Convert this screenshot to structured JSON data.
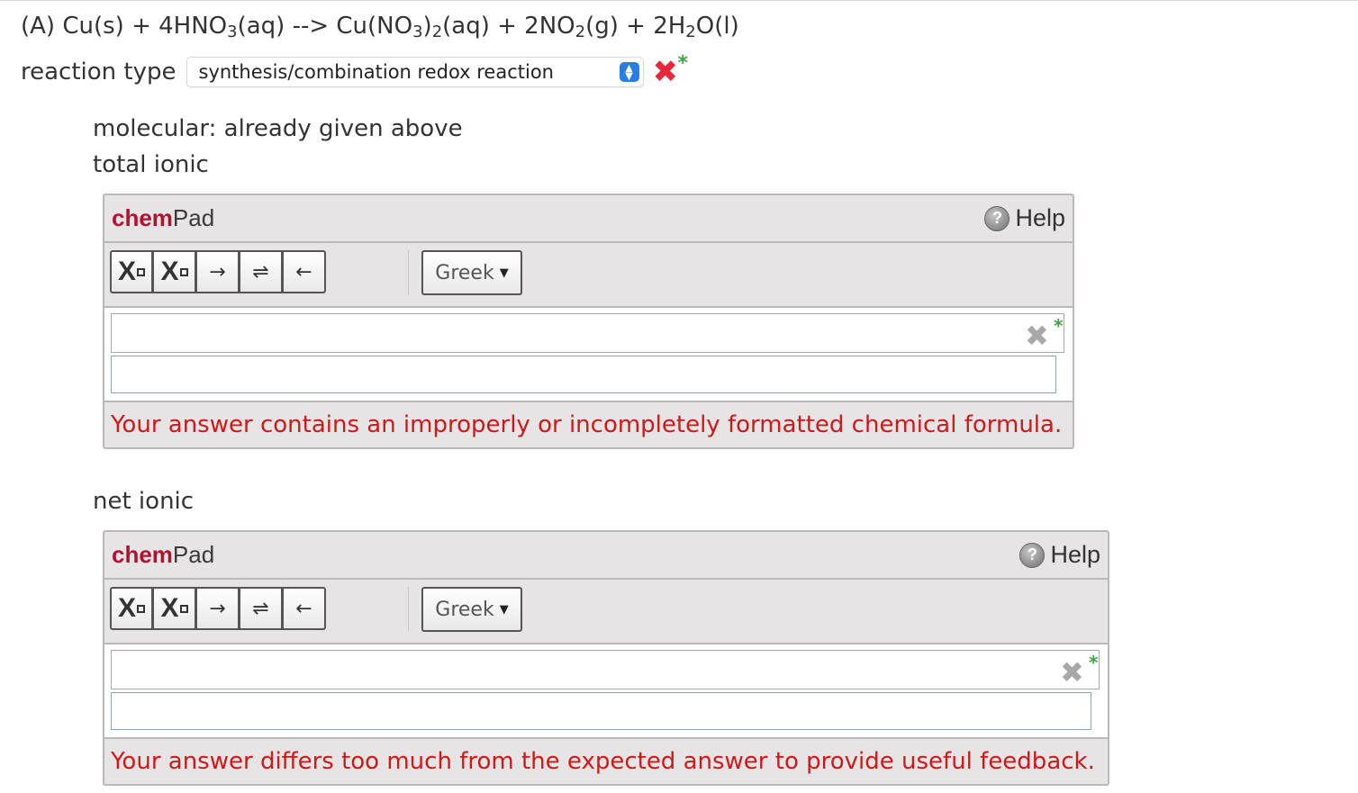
{
  "question": {
    "equation_parts": {
      "p1": "(A) Cu(s) + 4HNO",
      "s1": "3",
      "p2": "(aq) --> Cu(NO",
      "s2": "3",
      "p3": ")",
      "s3": "2",
      "p4": "(aq) + 2NO",
      "s4": "2",
      "p5": "(g) + 2H",
      "s5": "2",
      "p6": "O(l)"
    }
  },
  "reaction_type": {
    "label": "reaction type",
    "selected": "synthesis/combination redox reaction",
    "status_icon": "incorrect-x-icon",
    "status_color": "#e8283a",
    "required_star": "*"
  },
  "molecular": {
    "label": "molecular: already given above"
  },
  "total_ionic": {
    "label": "total ionic",
    "chempad": {
      "brand_chem": "chem",
      "brand_pad": "Pad",
      "help_label": "Help",
      "greek_label": "Greek",
      "answer": "",
      "feedback": "Your answer contains an improperly or incompletely formatted chemical formula."
    }
  },
  "net_ionic": {
    "label": "net ionic",
    "chempad": {
      "brand_chem": "chem",
      "brand_pad": "Pad",
      "help_label": "Help",
      "greek_label": "Greek",
      "answer": "",
      "feedback": "Your answer differs too much from the expected answer to provide useful feedback."
    }
  },
  "toolbar": {
    "subscript_letter": "X",
    "superscript_letter": "X",
    "arrow_right": "→",
    "arrow_equilibrium": "⇌",
    "arrow_left": "←"
  },
  "colors": {
    "brand_red": "#b5112e",
    "feedback_red": "#d01818",
    "star_green": "#3aa53a",
    "select_blue": "#2a7de1"
  }
}
